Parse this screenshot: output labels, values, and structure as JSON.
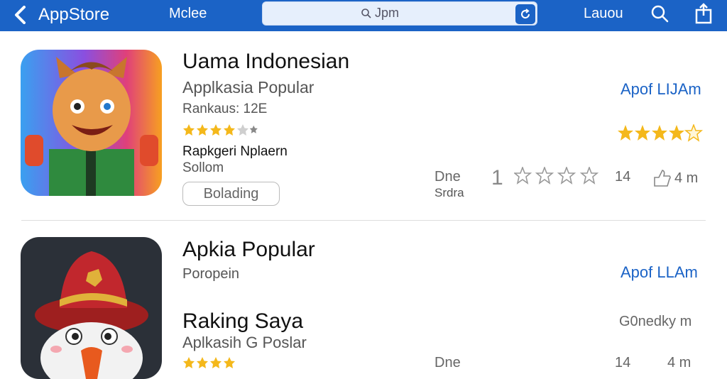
{
  "topbar": {
    "back_label": "AppStore",
    "left_text": "Mclee",
    "search_value": "Jpm",
    "right_text": "Lauou",
    "icons": [
      "chevron-left-icon",
      "search-icon",
      "refresh-icon",
      "share-icon"
    ]
  },
  "apps": [
    {
      "title": "Uama Indonesian",
      "subtitle": "Applkasia Popular",
      "ranking": "Rankaus: 12E",
      "rating_small": 4.5,
      "developer": "Rapkgeri Nplaern",
      "category": "Sollom",
      "button": "Bolading",
      "link": "Apof LIJAm",
      "rating_large": 4.5,
      "detail_label": "Dne",
      "detail_sub": "Srdra",
      "count_prefix": "1",
      "rating_outline": 0,
      "count": "14",
      "size": "4 m",
      "icon": "cat-mascot-icon"
    },
    {
      "title": "Apkia Popular",
      "subtitle": "Poropein",
      "link": "Apof LLAm",
      "icon": "bird-mascot-icon"
    },
    {
      "title": "Raking Saya",
      "subtitle": "Aplkasih G Poslar",
      "right_text": "G0nedky m",
      "detail_label": "Dne",
      "count": "14",
      "size": "4 m"
    }
  ],
  "colors": {
    "topbar": "#1b63c6",
    "link": "#1b63c6",
    "star": "#f4b81b"
  }
}
